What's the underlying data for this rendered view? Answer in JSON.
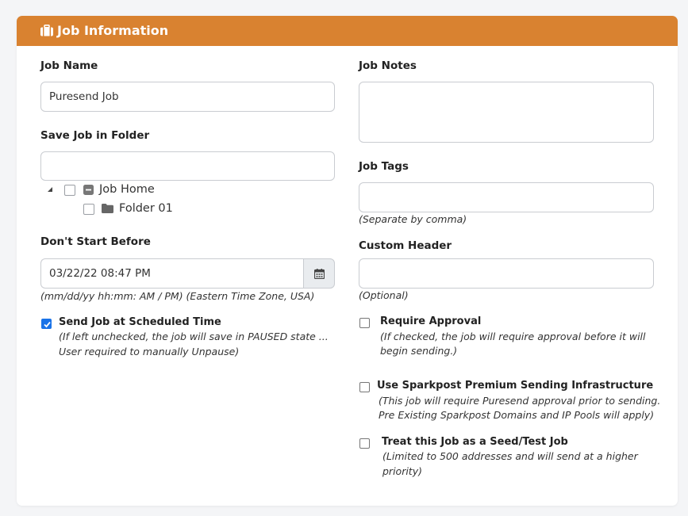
{
  "header": {
    "title": "Job Information",
    "icon": "briefcase-icon",
    "color": "#d98230"
  },
  "left": {
    "job_name": {
      "label": "Job Name",
      "value": "Puresend Job"
    },
    "folder": {
      "label": "Save Job in Folder",
      "value": "",
      "tree": [
        {
          "label": "Job Home",
          "icon": "collapse-icon",
          "checked": false
        },
        {
          "label": "Folder 01",
          "icon": "folder-icon",
          "checked": false
        }
      ]
    },
    "start": {
      "label": "Don't Start Before",
      "value": "03/22/22 08:47 PM",
      "hint": "(mm/dd/yy hh:mm: AM / PM) (Eastern Time Zone, USA)"
    },
    "scheduled": {
      "label": "Send Job at Scheduled Time",
      "checked": true,
      "hint_line1": "(If left unchecked, the job will save in PAUSED state ...",
      "hint_line2": "User required to manually Unpause)"
    }
  },
  "right": {
    "notes": {
      "label": "Job Notes",
      "value": ""
    },
    "tags": {
      "label": "Job Tags",
      "value": "",
      "hint": "(Separate by comma)"
    },
    "custom_header": {
      "label": "Custom Header",
      "value": "",
      "hint": "(Optional)"
    },
    "approval": {
      "label": "Require Approval",
      "checked": false,
      "hint_line1": "(If checked, the job will require approval before it will",
      "hint_line2": "begin sending.)"
    },
    "sparkpost": {
      "label": "Use Sparkpost Premium Sending Infrastructure",
      "checked": false,
      "hint_line1": "(This job will require Puresend approval prior to sending.",
      "hint_line2": "Pre Existing Sparkpost Domains and IP Pools will apply)"
    },
    "seed": {
      "label": "Treat this Job as a Seed/Test Job",
      "checked": false,
      "hint_line1": "(Limited to 500 addresses and will send at a higher",
      "hint_line2": "priority)"
    }
  }
}
